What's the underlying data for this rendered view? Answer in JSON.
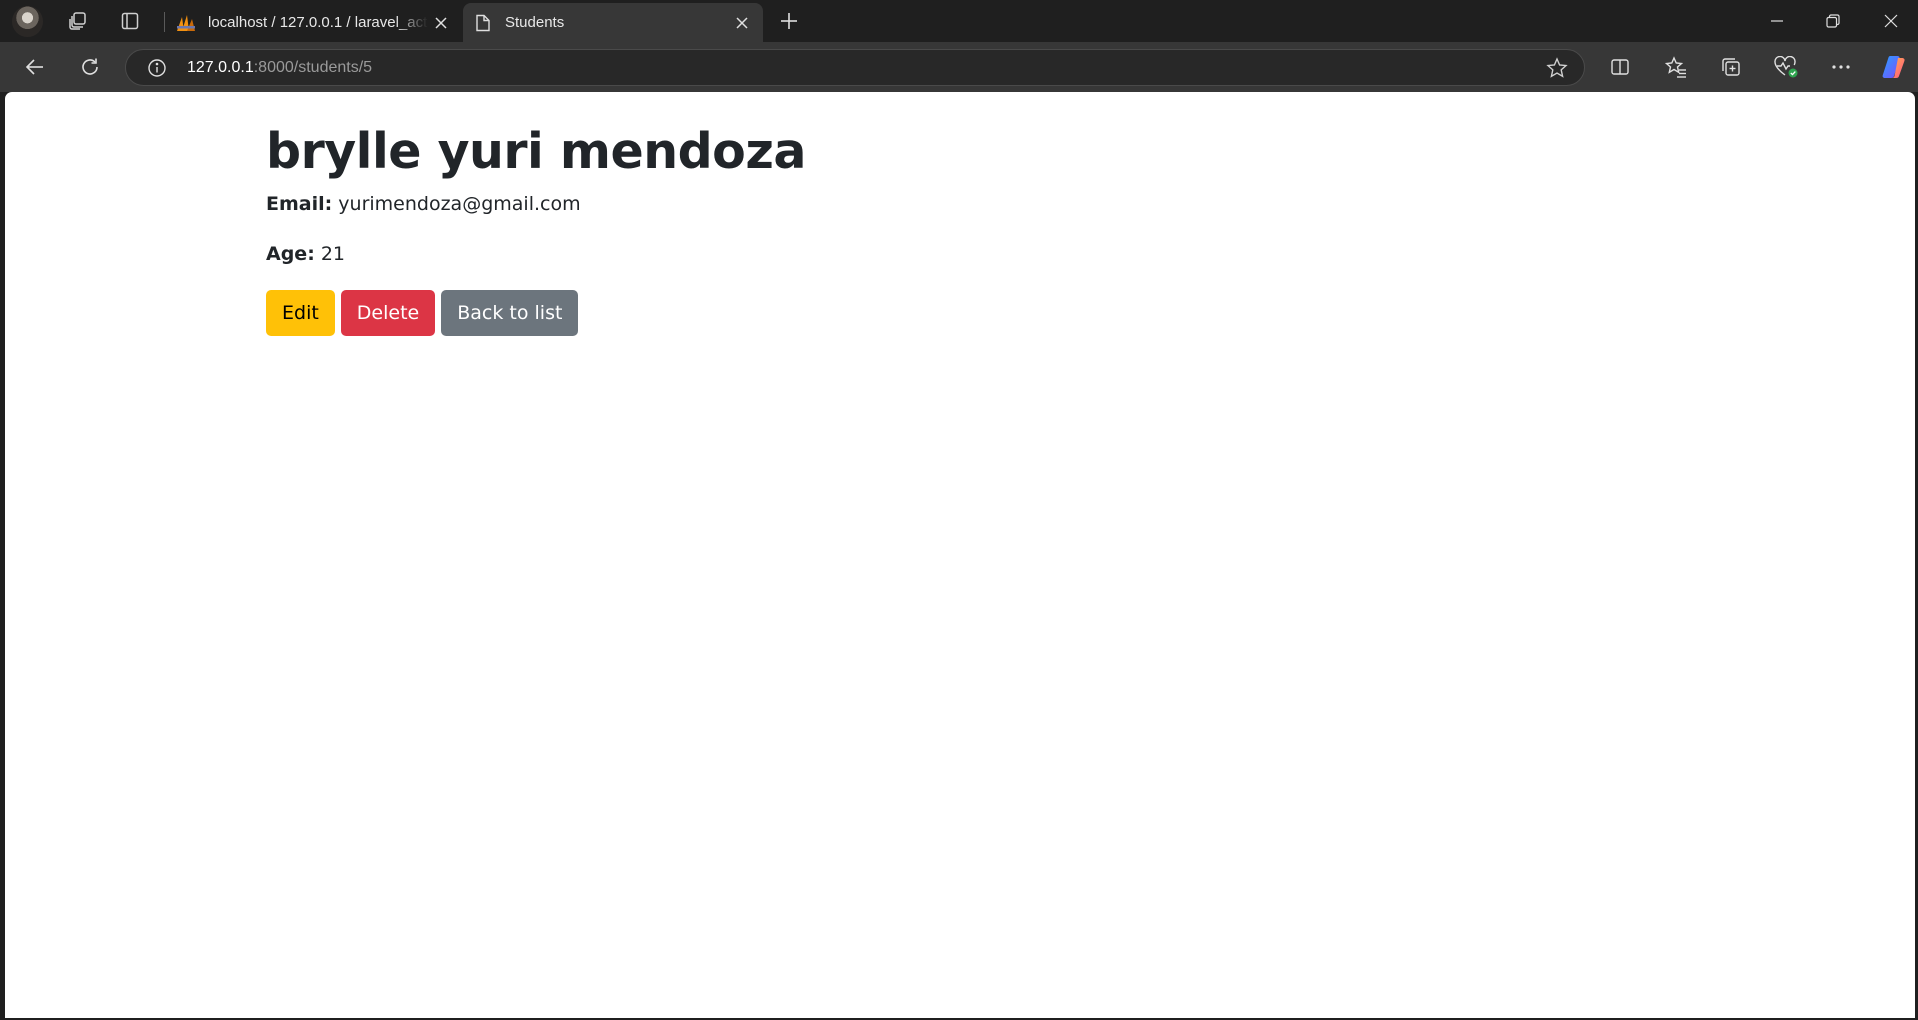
{
  "browser": {
    "tabs": [
      {
        "title": "localhost / 127.0.0.1 / laravel_activ",
        "favicon": "phpmyadmin-icon",
        "active": false
      },
      {
        "title": "Students",
        "favicon": "page-icon",
        "active": true
      }
    ],
    "address_bar": {
      "host": "127.0.0.1",
      "rest": ":8000/students/5"
    }
  },
  "page": {
    "name": "brylle yuri mendoza",
    "email_label": "Email:",
    "email": "yurimendoza@gmail.com",
    "age_label": "Age:",
    "age": "21",
    "buttons": {
      "edit": "Edit",
      "delete": "Delete",
      "back": "Back to list"
    }
  },
  "colors": {
    "warning": "#ffc107",
    "danger": "#dc3545",
    "secondary": "#6c757d"
  }
}
